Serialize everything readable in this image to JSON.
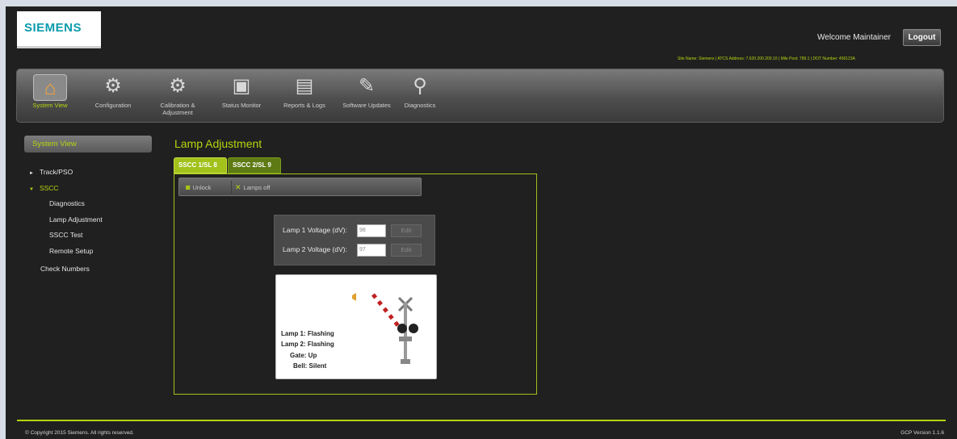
{
  "header": {
    "logo_text": "SIEMENS",
    "welcome": "Welcome Maintainer",
    "logout_label": "Logout",
    "site_info": "Site Name: Siemens | ATCS Address: 7.620.200.200.10 | Mile Post: 789.1 | DOT Number: 456123A"
  },
  "toolbar": {
    "items": [
      {
        "label": "System View",
        "icon": "house-icon",
        "active": true
      },
      {
        "label": "Configuration",
        "icon": "gears-icon"
      },
      {
        "label": "Calibration & Adjustment",
        "icon": "calibration-icon"
      },
      {
        "label": "Status Monitor",
        "icon": "monitor-icon"
      },
      {
        "label": "Reports & Logs",
        "icon": "report-icon"
      },
      {
        "label": "Software Updates",
        "icon": "software-update-icon"
      },
      {
        "label": "Diagnostics",
        "icon": "diagnostics-icon"
      }
    ]
  },
  "sidebar": {
    "header": "System View",
    "items": [
      {
        "label": "Track/PSO"
      },
      {
        "label": "SSCC"
      },
      {
        "label": "Diagnostics"
      },
      {
        "label": "Lamp Adjustment"
      },
      {
        "label": "SSCC Test"
      },
      {
        "label": "Remote Setup"
      },
      {
        "label": "Check Numbers"
      }
    ]
  },
  "main": {
    "title": "Lamp Adjustment",
    "tabs": [
      {
        "label": "SSCC 1/SL 8"
      },
      {
        "label": "SSCC 2/SL 9"
      }
    ],
    "actions": {
      "unlock_label": "Unlock",
      "lamps_off_label": "Lamps off"
    },
    "lamp1": {
      "label": "Lamp 1 Voltage (dV):",
      "value": "98",
      "edit_label": "Edit"
    },
    "lamp2": {
      "label": "Lamp 2 Voltage (dV):",
      "value": "97",
      "edit_label": "Edit"
    },
    "status": {
      "lamp1": "Lamp 1: Flashing",
      "lamp2": "Lamp 2: Flashing",
      "gate": "Gate: Up",
      "bell": "Bell: Silent"
    }
  },
  "footer": {
    "copyright": "© Copyright 2015 Siemens. All rights reserved.",
    "version": "GCP Version 1.1.6"
  },
  "colors": {
    "accent": "#b8d410",
    "tab_active": "#a2c11b",
    "background": "#202020"
  }
}
